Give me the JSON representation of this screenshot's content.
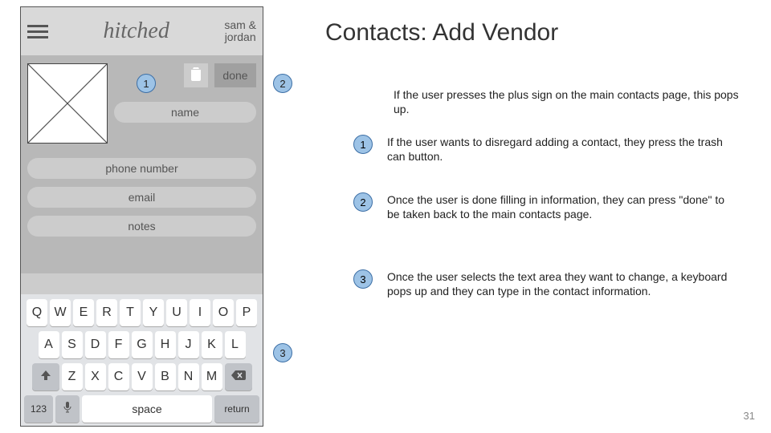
{
  "page_title": "Contacts: Add Vendor",
  "page_number": "31",
  "intro": "If the user presses the plus sign on the main contacts page, this pops up.",
  "notes": [
    {
      "num": "1",
      "text": "If the user wants to disregard adding a contact, they press the trash can button."
    },
    {
      "num": "2",
      "text": "Once the user is done filling in information, they can press \"done\" to be taken back to the main contacts page."
    },
    {
      "num": "3",
      "text": "Once the user selects the text area they want to change, a keyboard pops up and they can type in the contact information."
    }
  ],
  "phone": {
    "logo": "hitched",
    "couple": "sam &\njordan",
    "done_label": "done",
    "fields": {
      "name": "name",
      "phone": "phone number",
      "email": "email",
      "notes": "notes"
    }
  },
  "keyboard": {
    "row1": [
      "Q",
      "W",
      "E",
      "R",
      "T",
      "Y",
      "U",
      "I",
      "O",
      "P"
    ],
    "row2": [
      "A",
      "S",
      "D",
      "F",
      "G",
      "H",
      "J",
      "K",
      "L"
    ],
    "row3": [
      "Z",
      "X",
      "C",
      "V",
      "B",
      "N",
      "M"
    ],
    "numkey": "123",
    "space": "space",
    "return": "return"
  },
  "callouts": {
    "c1": "1",
    "c2": "2",
    "c3": "3"
  }
}
